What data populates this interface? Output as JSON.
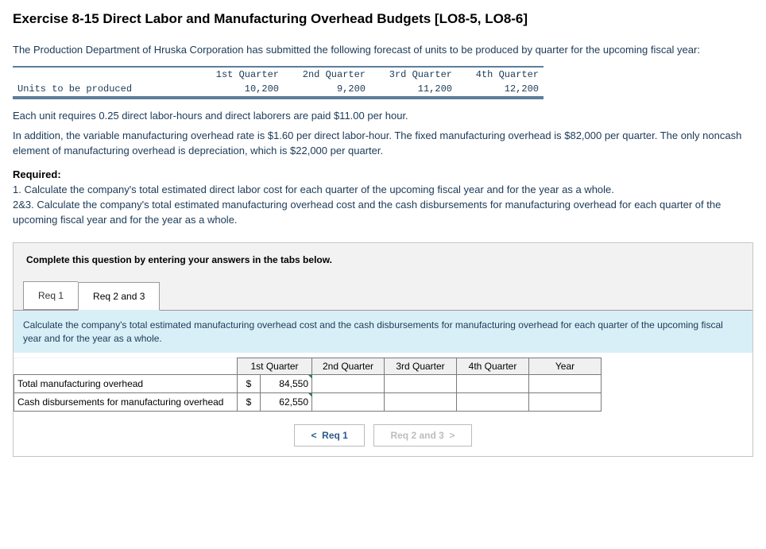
{
  "title": "Exercise 8-15 Direct Labor and Manufacturing Overhead Budgets [LO8-5, LO8-6]",
  "intro": "The Production Department of Hruska Corporation has submitted the following forecast of units to be produced by quarter for the upcoming fiscal year:",
  "forecast": {
    "row_label": "Units to be produced",
    "headers": [
      "1st Quarter",
      "2nd Quarter",
      "3rd Quarter",
      "4th Quarter"
    ],
    "values": [
      "10,200",
      "9,200",
      "11,200",
      "12,200"
    ]
  },
  "para2": "Each unit requires 0.25 direct labor-hours and direct laborers are paid $11.00 per hour.",
  "para3": "In addition, the variable manufacturing overhead rate is $1.60 per direct labor-hour. The fixed manufacturing overhead is $82,000 per quarter. The only noncash element of manufacturing overhead is depreciation, which is $22,000 per quarter.",
  "required_label": "Required:",
  "required_1": "1. Calculate the company's total estimated direct labor cost for each quarter of the upcoming fiscal year and for the year as a whole.",
  "required_23": "2&3. Calculate the company's total estimated manufacturing overhead cost and the cash disbursements for manufacturing overhead for each quarter of the upcoming fiscal year and for the year as a whole.",
  "instruction": "Complete this question by entering your answers in the tabs below.",
  "tabs": {
    "req1": "Req 1",
    "req23": "Req 2 and 3"
  },
  "tab_desc": "Calculate the company's total estimated manufacturing overhead cost and the cash disbursements for manufacturing overhead for each quarter of the upcoming fiscal year and for the year as a whole.",
  "answer_headers": [
    "1st Quarter",
    "2nd Quarter",
    "3rd Quarter",
    "4th Quarter",
    "Year"
  ],
  "rows": {
    "tmo": {
      "label": "Total manufacturing overhead",
      "dollar": "$",
      "value": "84,550"
    },
    "cash": {
      "label": "Cash disbursements for manufacturing overhead",
      "dollar": "$",
      "value": "62,550"
    }
  },
  "nav": {
    "prev": "Req 1",
    "next": "Req 2 and 3"
  }
}
